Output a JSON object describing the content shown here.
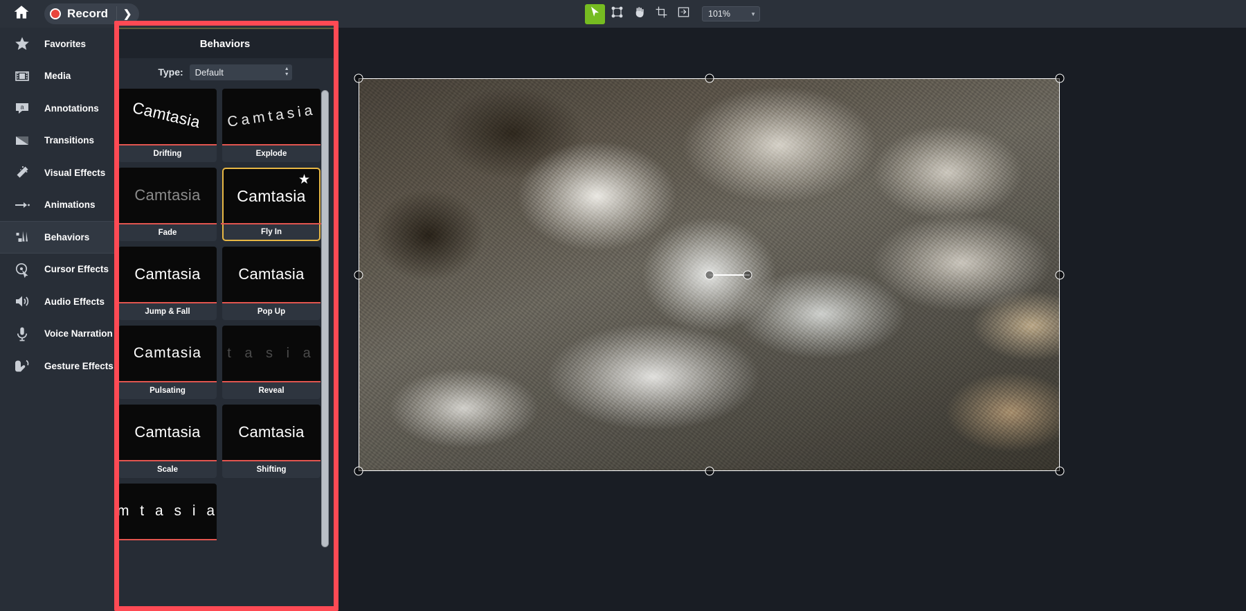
{
  "topbar": {
    "home_icon": "home-icon",
    "record_label": "Record",
    "record_dot": "record-dot-icon",
    "record_chevron": "chevron-right-icon",
    "tools": [
      {
        "name": "select-tool",
        "icon": "cursor-arrow-icon",
        "active": true
      },
      {
        "name": "edit-points-tool",
        "icon": "edit-points-icon",
        "active": false
      },
      {
        "name": "hand-tool",
        "icon": "hand-icon",
        "active": false
      },
      {
        "name": "crop-tool",
        "icon": "crop-icon",
        "active": false
      },
      {
        "name": "transform-tool",
        "icon": "transform-icon",
        "active": false
      }
    ],
    "zoom_value": "101%",
    "zoom_caret": "chevron-down-icon"
  },
  "sidebar": {
    "items": [
      {
        "label": "Favorites",
        "icon": "star-icon",
        "active": false
      },
      {
        "label": "Media",
        "icon": "film-strip-icon",
        "active": false
      },
      {
        "label": "Annotations",
        "icon": "callout-a-icon",
        "active": false
      },
      {
        "label": "Transitions",
        "icon": "transition-icon",
        "active": false
      },
      {
        "label": "Visual Effects",
        "icon": "magic-wand-icon",
        "active": false
      },
      {
        "label": "Animations",
        "icon": "arrow-animate-icon",
        "active": false
      },
      {
        "label": "Behaviors",
        "icon": "behaviors-icon",
        "active": true
      },
      {
        "label": "Cursor Effects",
        "icon": "cursor-effects-icon",
        "active": false
      },
      {
        "label": "Audio Effects",
        "icon": "speaker-icon",
        "active": false
      },
      {
        "label": "Voice Narration",
        "icon": "microphone-icon",
        "active": false
      },
      {
        "label": "Gesture Effects",
        "icon": "hand-gesture-icon",
        "active": false
      }
    ]
  },
  "panel": {
    "title": "Behaviors",
    "type_label": "Type:",
    "type_value": "Default",
    "type_caret": "spinner-arrows-icon",
    "scrollbar": "vertical-scrollbar",
    "tiles": [
      {
        "label": "Drifting",
        "preview": "Camtasia",
        "style": "drift",
        "selected": false,
        "favorite": false
      },
      {
        "label": "Explode",
        "preview": "Camtasia",
        "style": "explode",
        "selected": false,
        "favorite": false
      },
      {
        "label": "Fade",
        "preview": "Camtasia",
        "style": "fade",
        "selected": false,
        "favorite": false
      },
      {
        "label": "Fly In",
        "preview": "Camtasia",
        "style": "flyin",
        "selected": true,
        "favorite": true
      },
      {
        "label": "Jump & Fall",
        "preview": "Camtasia",
        "style": "jump",
        "selected": false,
        "favorite": false
      },
      {
        "label": "Pop Up",
        "preview": "Camtasia",
        "style": "popup",
        "selected": false,
        "favorite": false
      },
      {
        "label": "Pulsating",
        "preview": "Camtasia",
        "style": "pulse",
        "selected": false,
        "favorite": false
      },
      {
        "label": "Reveal",
        "preview": "t a s i a",
        "style": "reveal",
        "selected": false,
        "favorite": false
      },
      {
        "label": "Scale",
        "preview": "Camtasia",
        "style": "scale",
        "selected": false,
        "favorite": false
      },
      {
        "label": "Shifting",
        "preview": "Camtasia",
        "style": "shift",
        "selected": false,
        "favorite": false
      },
      {
        "label": "",
        "preview": "m  t a s i a",
        "style": "partial",
        "selected": false,
        "favorite": false
      }
    ]
  },
  "canvas": {
    "image_alt": "mountain-stream-rocks-photo",
    "selection": "media-selection-frame",
    "handles": 9
  },
  "highlight": {
    "color": "#fe4a54",
    "name": "behaviors-panel-highlight"
  }
}
